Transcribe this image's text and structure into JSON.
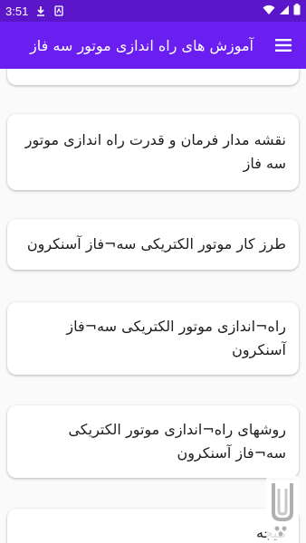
{
  "status_bar": {
    "time": "3:51",
    "icons": [
      "download-icon",
      "sim-card-icon",
      "wifi-icon",
      "signal-icon",
      "battery-icon"
    ]
  },
  "app_bar": {
    "title": "آموزش های راه اندازی موتور سه فاز",
    "menu_icon": "hamburger-menu-icon"
  },
  "list": {
    "items": [
      {
        "label": ""
      },
      {
        "label": "نقشه مدار فرمان و قدرت راه اندازی موتور سه فاز"
      },
      {
        "label": "طرز کار موتور الکتریکی سه¬فاز آسنکرون"
      },
      {
        "label": "راه¬اندازی موتور الکتریکی سه¬فاز آسنکرون"
      },
      {
        "label": "روشهای راه¬اندازی موتور الکتریکی سه¬فاز آسنکرون"
      },
      {
        "label": "نتیجه"
      }
    ]
  },
  "colors": {
    "status_bar": "#5b16c9",
    "app_bar": "#6a1ef0",
    "background": "#fafafa",
    "card": "#ffffff",
    "text": "#1e1e1e"
  }
}
